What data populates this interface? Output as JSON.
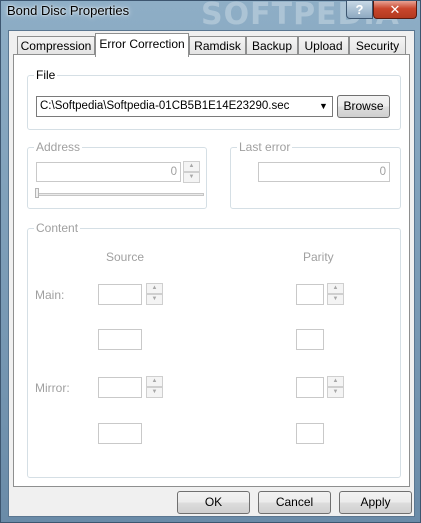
{
  "window": {
    "title": "Bond Disc Properties",
    "watermark": "SOFTPEDIA",
    "help_glyph": "?",
    "close_glyph": "✕"
  },
  "tabs": [
    {
      "label": "Compression"
    },
    {
      "label": "Error Correction",
      "active": true
    },
    {
      "label": "Ramdisk"
    },
    {
      "label": "Backup"
    },
    {
      "label": "Upload"
    },
    {
      "label": "Security"
    }
  ],
  "file": {
    "label": "File",
    "value": "C:\\Softpedia\\Softpedia-01CB5B1E14E23290.sec",
    "browse_label": "Browse"
  },
  "address": {
    "label": "Address",
    "value": "0"
  },
  "last_error": {
    "label": "Last error",
    "value": "0"
  },
  "content": {
    "label": "Content",
    "source_label": "Source",
    "parity_label": "Parity",
    "main_label": "Main:",
    "mirror_label": "Mirror:"
  },
  "buttons": {
    "ok": "OK",
    "cancel": "Cancel",
    "apply": "Apply"
  },
  "icons": {
    "spin_up": "▲",
    "spin_down": "▼",
    "dropdown": "▼"
  }
}
